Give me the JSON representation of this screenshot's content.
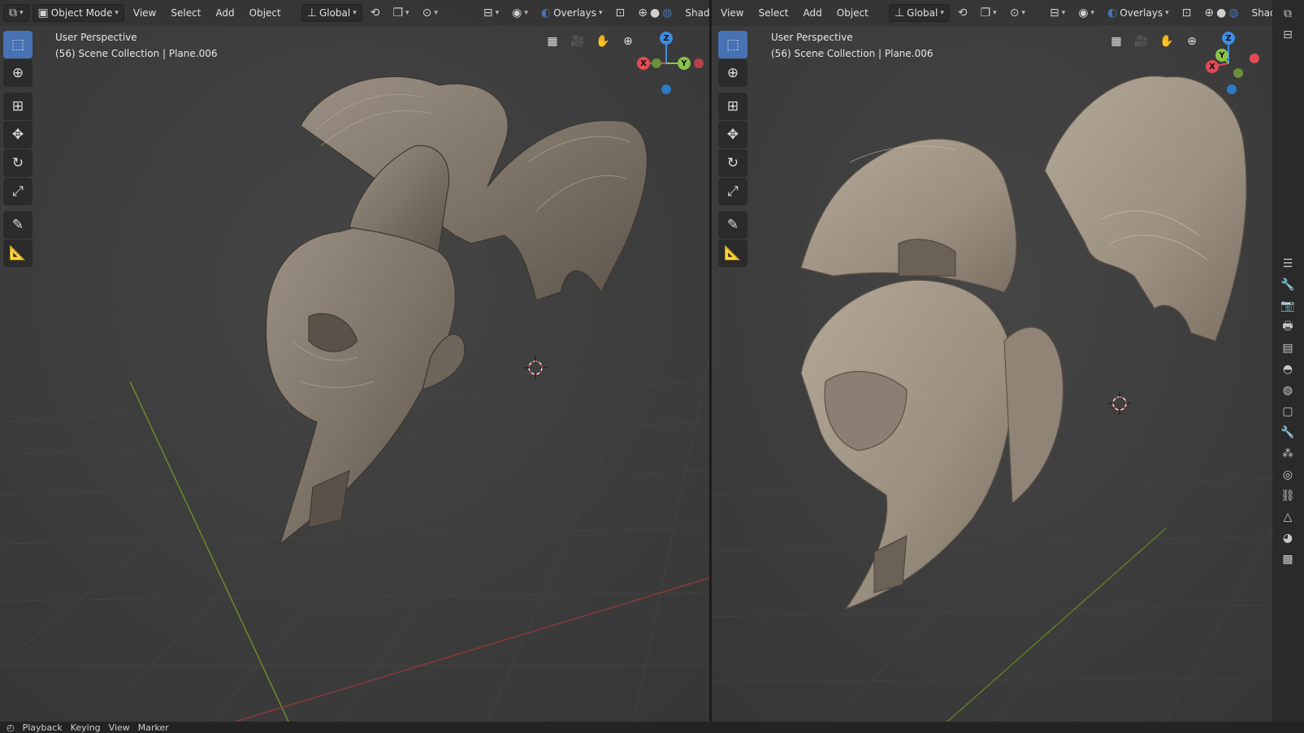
{
  "left_header": {
    "mode": "Object Mode",
    "menus": [
      "View",
      "Select",
      "Add",
      "Object"
    ],
    "orientation": "Global",
    "overlays": "Overlays",
    "shading": "Shading"
  },
  "right_header": {
    "menus": [
      "View",
      "Select",
      "Add",
      "Object"
    ],
    "orientation": "Global",
    "overlays": "Overlays",
    "shading": "Shading"
  },
  "left_viewport": {
    "view_name": "User Perspective",
    "collection": "(56) Scene Collection | Plane.006"
  },
  "right_viewport": {
    "view_name": "User Perspective",
    "collection": "(56) Scene Collection | Plane.006"
  },
  "gizmo": {
    "x": "X",
    "y": "Y",
    "z": "Z"
  },
  "colors": {
    "viewport_bg": "#3d3d3d",
    "accent": "#4772b3",
    "axis_x": "#e34a55",
    "axis_y": "#8bc34a",
    "axis_z": "#3f8de0",
    "model": "#8a7f72"
  },
  "timeline": {
    "items": [
      "Playback",
      "Keying",
      "View",
      "Marker"
    ]
  }
}
